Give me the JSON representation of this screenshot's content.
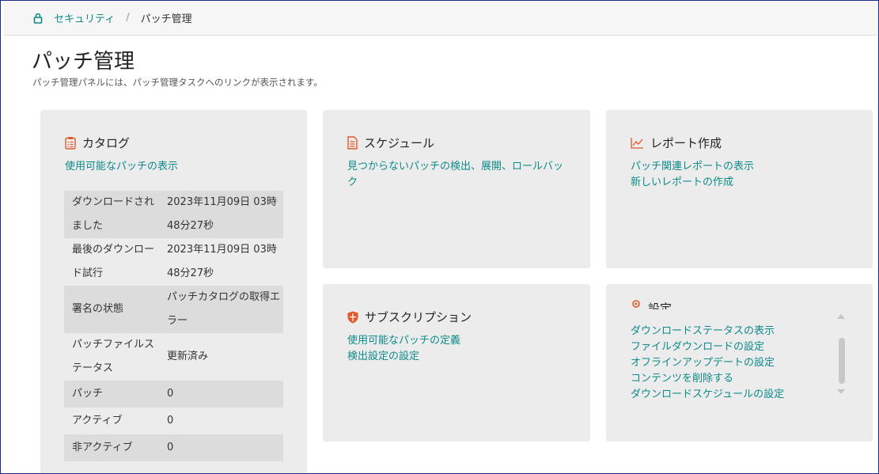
{
  "breadcrumb": {
    "root": "セキュリティ",
    "separator": "/",
    "current": "パッチ管理"
  },
  "page": {
    "title": "パッチ管理",
    "description": "パッチ管理パネルには、パッチ管理タスクへのリンクが表示されます。"
  },
  "catalog": {
    "title": "カタログ",
    "link": "使用可能なパッチの表示",
    "rows": [
      {
        "key": "ダウンロードされました",
        "value": "2023年11月09日 03時48分27秒"
      },
      {
        "key": "最後のダウンロード試行",
        "value": "2023年11月09日 03時48分27秒"
      },
      {
        "key": "署名の状態",
        "value": "パッチカタログの取得エラー"
      },
      {
        "key": "パッチファイルステータス",
        "value": "更新済み"
      },
      {
        "key": "パッチ",
        "value": "0"
      },
      {
        "key": "アクティブ",
        "value": "0"
      },
      {
        "key": "非アクティブ",
        "value": "0"
      }
    ]
  },
  "schedule": {
    "title": "スケジュール",
    "links": [
      "見つからないパッチの検出、展開、ロールバック"
    ]
  },
  "report": {
    "title": "レポート作成",
    "links": [
      "パッチ関連レポートの表示",
      "新しいレポートの作成"
    ]
  },
  "subscription": {
    "title": "サブスクリプション",
    "links": [
      "使用可能なパッチの定義",
      "検出設定の設定"
    ]
  },
  "settings": {
    "title": "設定",
    "links": [
      "ダウンロードステータスの表示",
      "ファイルダウンロードの設定",
      "オフラインアップデートの設定",
      "コンテンツを削除する",
      "ダウンロードスケジュールの設定"
    ]
  },
  "colors": {
    "accent": "#0e8a8a",
    "icon": "#e05a2b",
    "card": "#ececec"
  },
  "icons": {
    "breadcrumb": "lock-icon",
    "catalog": "clipboard-icon",
    "schedule": "document-icon",
    "report": "line-chart-icon",
    "subscription": "shield-icon",
    "settings": "gear-icon"
  }
}
